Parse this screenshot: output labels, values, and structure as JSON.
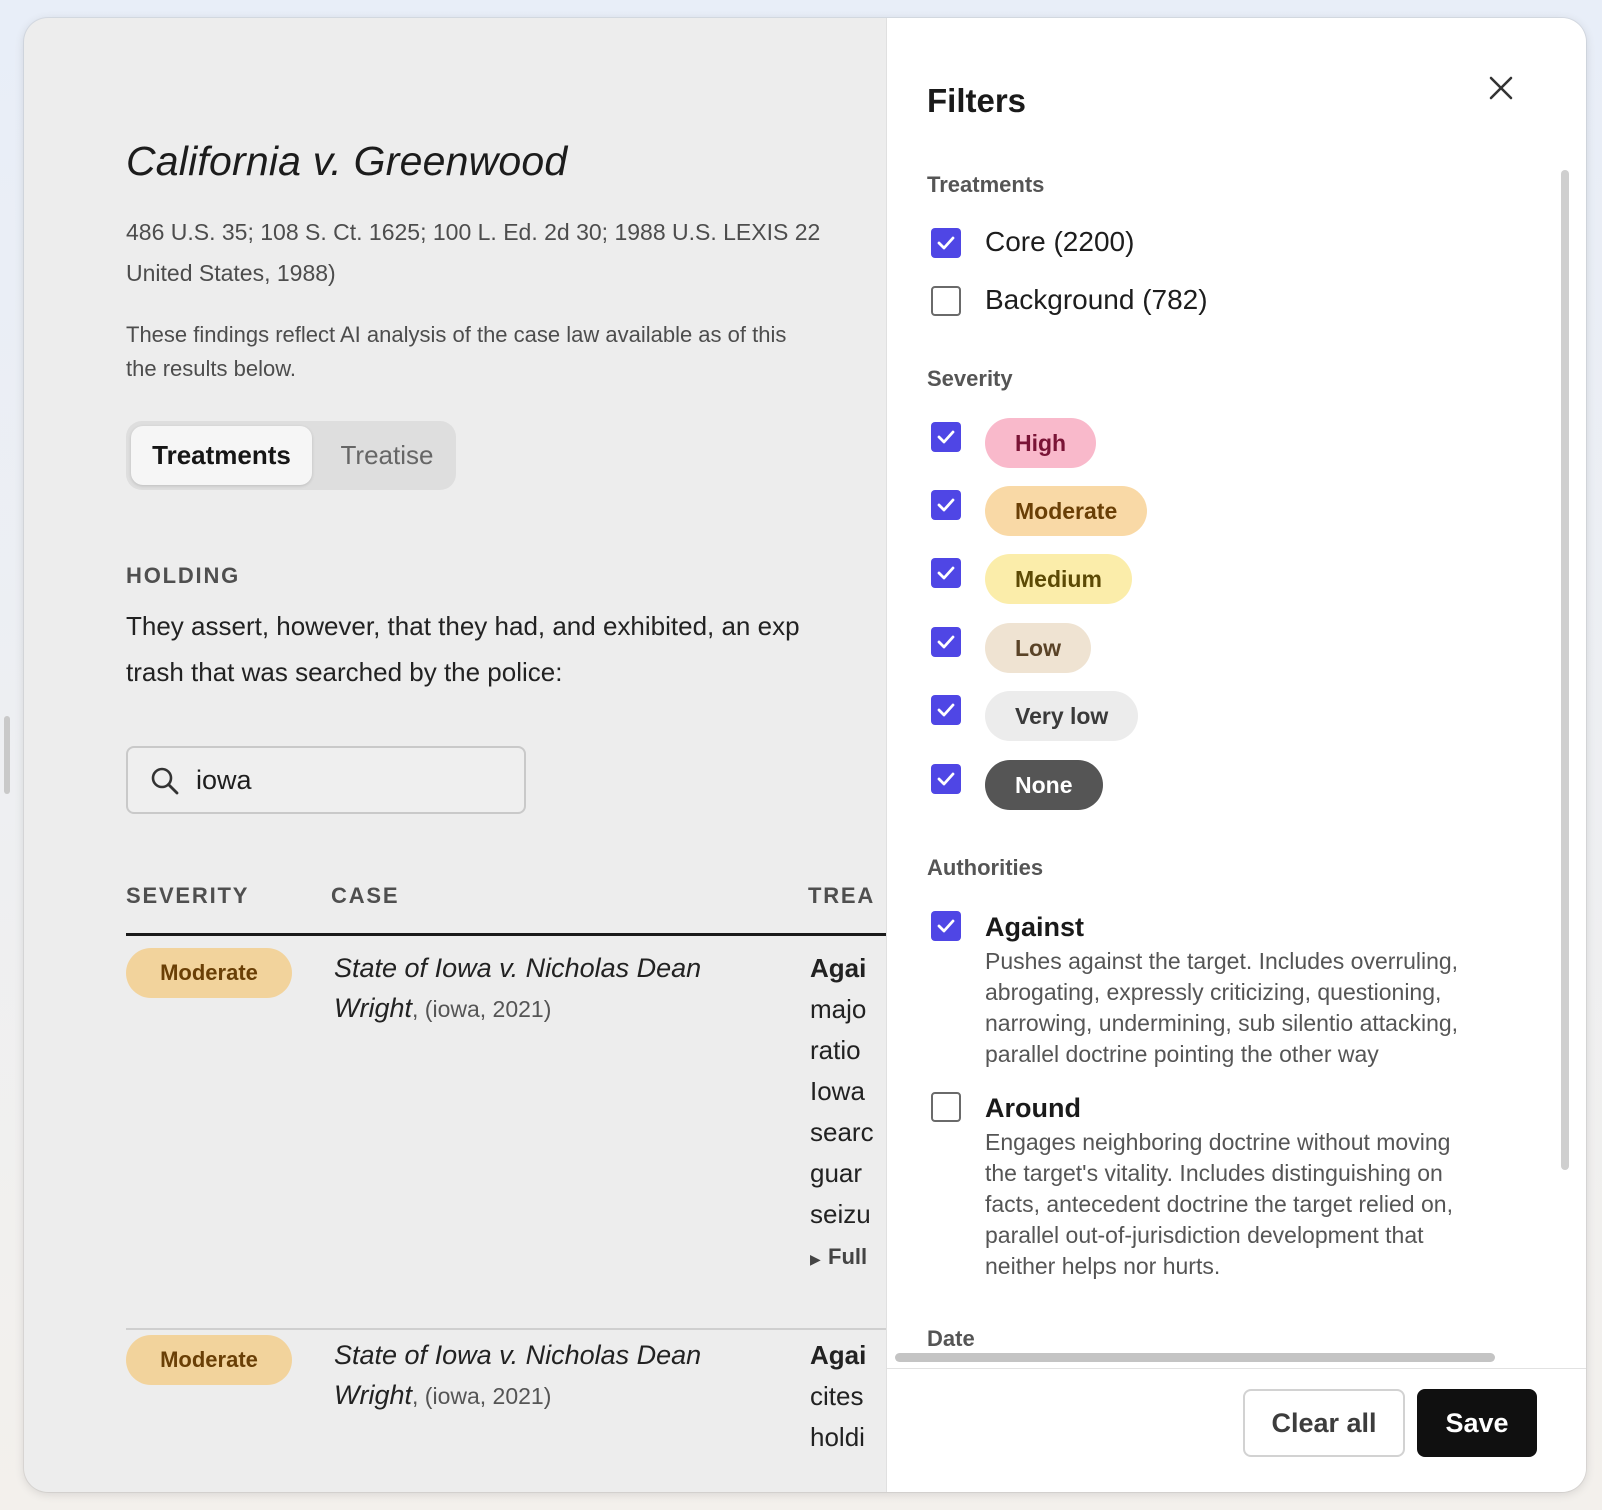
{
  "case": {
    "title": "California v. Greenwood",
    "citation": "486 U.S. 35; 108 S. Ct. 1625; 100 L. Ed. 2d 30; 1988 U.S. LEXIS 22",
    "citation_cont": "United States, 1988)",
    "disclaimer_1": "These findings reflect AI analysis of the case law available as of this",
    "disclaimer_2": "the results below."
  },
  "tabs": {
    "active": "Treatments",
    "inactive": "Treatise"
  },
  "holding": {
    "label": "HOLDING",
    "line1": "They assert, however, that they had, and exhibited, an exp",
    "line2": "trash that was searched by the police:"
  },
  "search": {
    "value": "iowa",
    "icon": "search-icon"
  },
  "table": {
    "headers": {
      "severity": "SEVERITY",
      "case": "CASE",
      "treatment": "TREA"
    },
    "rows": [
      {
        "severity": "Moderate",
        "case_name_1": "State of Iowa v. Nicholas Dean",
        "case_name_2": "Wright",
        "case_meta": ", (iowa, 2021)",
        "treat_lines": [
          "Agai",
          "majo",
          "ratio",
          "Iowa",
          "searc",
          "guar",
          "seizu"
        ],
        "full_link": "Full"
      },
      {
        "severity": "Moderate",
        "case_name_1": "State of Iowa v. Nicholas Dean",
        "case_name_2": "Wright",
        "case_meta": ", (iowa, 2021)",
        "treat_lines": [
          "Agai",
          "cites",
          "holdi"
        ]
      }
    ]
  },
  "filters": {
    "title": "Filters",
    "treatments": {
      "label": "Treatments",
      "options": [
        {
          "label": "Core (2200)",
          "checked": true
        },
        {
          "label": "Background (782)",
          "checked": false
        }
      ]
    },
    "severity": {
      "label": "Severity",
      "options": [
        {
          "label": "High",
          "checked": true,
          "bg": "#f9b9cb",
          "fg": "#7a1436"
        },
        {
          "label": "Moderate",
          "checked": true,
          "bg": "#f9d9a6",
          "fg": "#6a3f06"
        },
        {
          "label": "Medium",
          "checked": true,
          "bg": "#fbedaa",
          "fg": "#5c4a05"
        },
        {
          "label": "Low",
          "checked": true,
          "bg": "#efe3d2",
          "fg": "#5a4327"
        },
        {
          "label": "Very low",
          "checked": true,
          "bg": "#ececec",
          "fg": "#3a3a3a"
        },
        {
          "label": "None",
          "checked": true,
          "bg": "#555555",
          "fg": "#ffffff"
        }
      ]
    },
    "authorities": {
      "label": "Authorities",
      "options": [
        {
          "title": "Against",
          "checked": true,
          "desc": [
            "Pushes against the target. Includes overruling,",
            "abrogating, expressly criticizing, questioning,",
            "narrowing, undermining, sub silentio attacking,",
            "parallel doctrine pointing the other way"
          ]
        },
        {
          "title": "Around",
          "checked": false,
          "desc": [
            "Engages neighboring doctrine without moving",
            "the target's vitality. Includes distinguishing on",
            "facts, antecedent doctrine the target relied on,",
            "parallel out-of-jurisdiction development that",
            "neither helps nor hurts."
          ]
        }
      ]
    },
    "date": {
      "label": "Date"
    },
    "clear_label": "Clear all",
    "save_label": "Save"
  },
  "colors": {
    "accent": "#4f46e5",
    "moderate_bg": "#f2d39c"
  }
}
